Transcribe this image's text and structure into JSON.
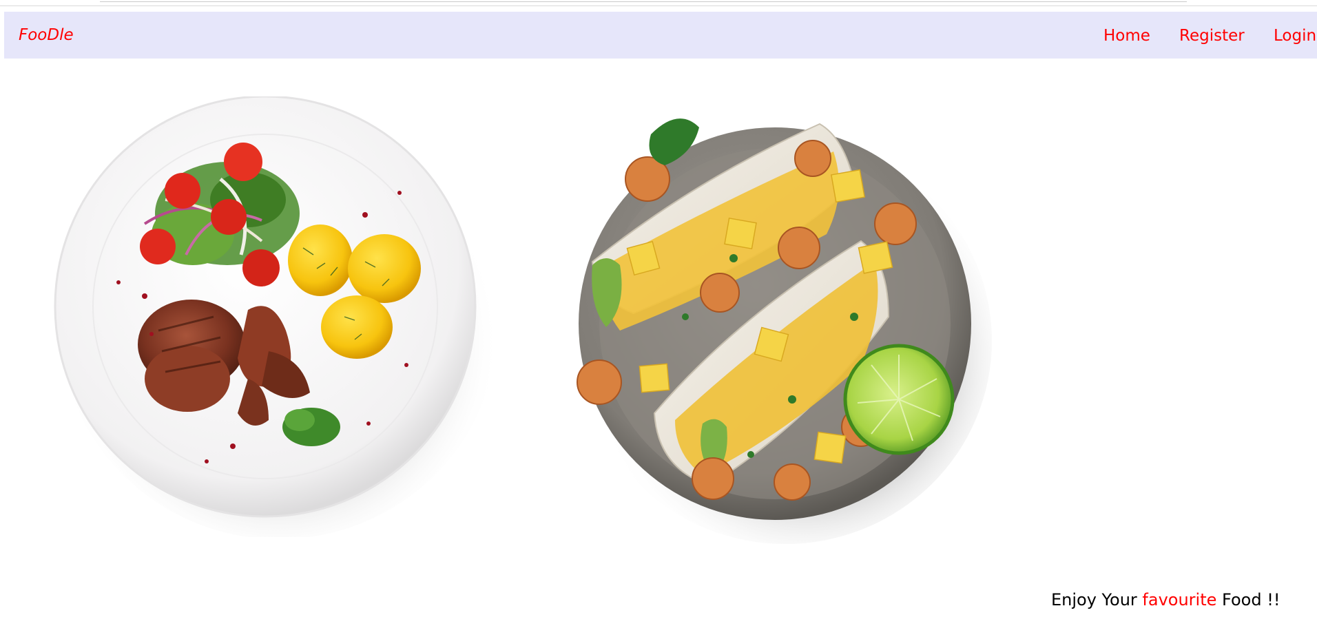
{
  "navbar": {
    "brand": "FooDle",
    "links": [
      {
        "label": "Home"
      },
      {
        "label": "Register"
      },
      {
        "label": "Login"
      }
    ]
  },
  "hero": {
    "images": [
      {
        "alt": "plate-with-steak-salad-and-potatoes"
      },
      {
        "alt": "plate-with-shrimp-tacos-and-lime"
      }
    ]
  },
  "tagline": {
    "part1": "Enjoy Your ",
    "accent": "favourite",
    "part2": " Food !!"
  },
  "colors": {
    "navbar_bg": "#e6e6fa",
    "accent": "#ff0000",
    "text": "#000000"
  }
}
